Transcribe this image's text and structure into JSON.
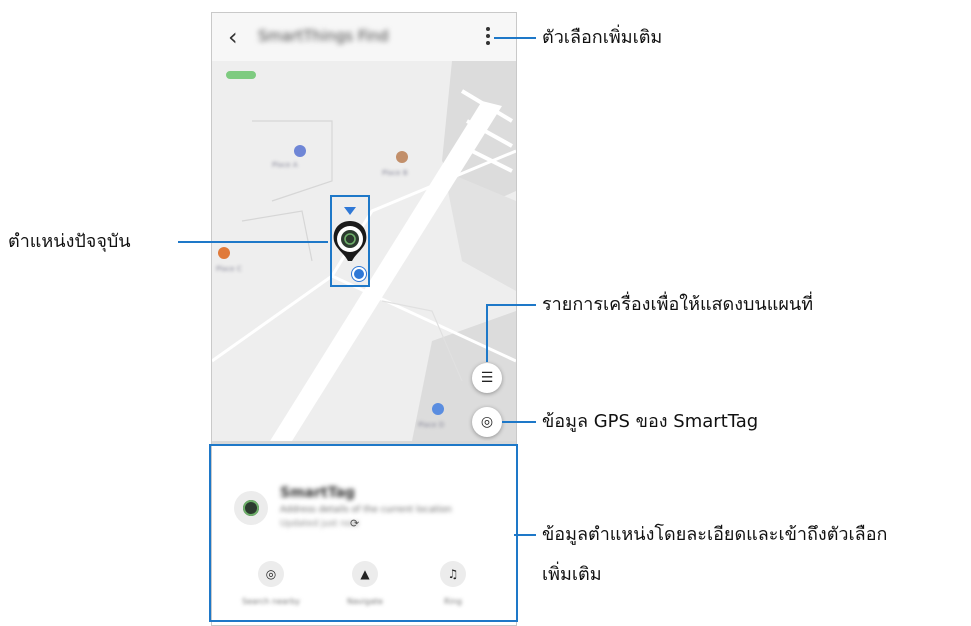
{
  "app": {
    "title": "SmartThings Find",
    "back_icon": "chevron-left-icon",
    "menu_icon": "more-vertical-icon"
  },
  "map": {
    "place_labels": [
      "Place A",
      "Place B",
      "Place C",
      "Place D"
    ],
    "list_button_icon": "list-icon",
    "gps_button_icon": "locate-icon"
  },
  "panel": {
    "device_name": "SmartTag",
    "address": "Address details of the current location",
    "time": "Updated just now",
    "refresh_icon": "refresh-icon",
    "actions": [
      {
        "icon": "search-nearby-icon",
        "label": "Search nearby"
      },
      {
        "icon": "navigate-icon",
        "label": "Navigate"
      },
      {
        "icon": "ring-icon",
        "label": "Ring"
      }
    ]
  },
  "callouts": {
    "more_options": "ตัวเลือกเพิ่มเติม",
    "current_location": "ตำแหน่งปัจจุบัน",
    "list_devices": "รายการเครื่องเพื่อให้แสดงบนแผนที่",
    "gps_info": "ข้อมูล GPS ของ SmartTag",
    "details_line1": "ข้อมูลตำแหน่งโดยละเอียดและเข้าถึงตัวเลือก",
    "details_line2": "เพิ่มเติม"
  },
  "colors": {
    "accent": "#1e78c8",
    "map_bg": "#eeeeee",
    "road": "#ffffff",
    "block": "#dcdcdc"
  }
}
